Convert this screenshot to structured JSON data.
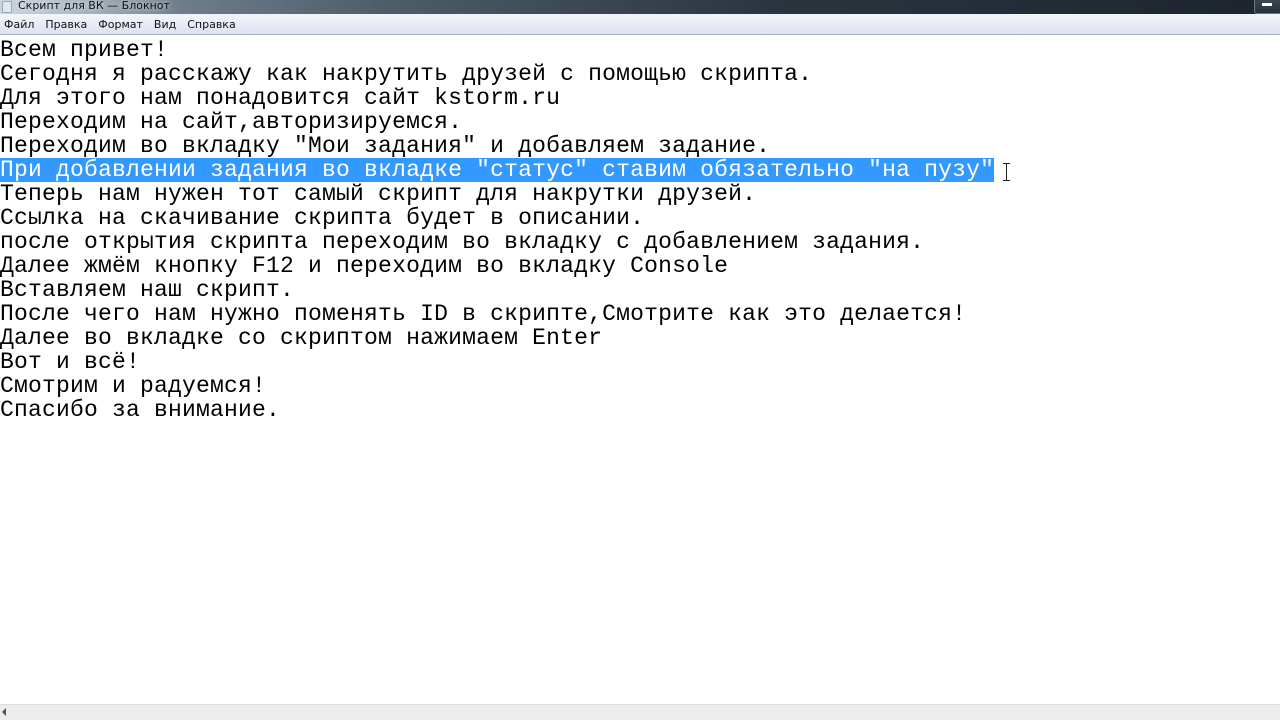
{
  "window": {
    "title": "Скрипт для ВК — Блокнот",
    "app_icon": "notepad-icon"
  },
  "menu": {
    "items": [
      {
        "label": "Файл"
      },
      {
        "label": "Правка"
      },
      {
        "label": "Формат"
      },
      {
        "label": "Вид"
      },
      {
        "label": "Справка"
      }
    ]
  },
  "editor": {
    "selected_line_index": 5,
    "selection_color": "#3399ff",
    "lines": [
      "Всем привет!",
      "Сегодня я расскажу как накрутить друзей с помощью скрипта.",
      "Для этого нам понадовится сайт kstorm.ru",
      "Переходим на сайт,авторизируемся.",
      "Переходим во вкладку \"Мои задания\" и добавляем задание.",
      "При добавлении задания во вкладке \"статус\" ставим обязательно \"на пузу\"",
      "Теперь нам нужен тот самый скрипт для накрутки друзей.",
      "Ссылка на скачивание скрипта будет в описании.",
      "после открытия скрипта переходим во вкладку с добавлением задания.",
      "Далее жмём кнопку F12 и переходим во вкладку Console",
      "Вставляем наш скрипт.",
      "После чего нам нужно поменять ID в скрипте,Смотрите как это делается!",
      "Далее во вкладке со скриптом нажимаем Enter",
      "Вот и всё!",
      "Смотрим и радуемся!",
      "Спасибо за внимание."
    ]
  }
}
